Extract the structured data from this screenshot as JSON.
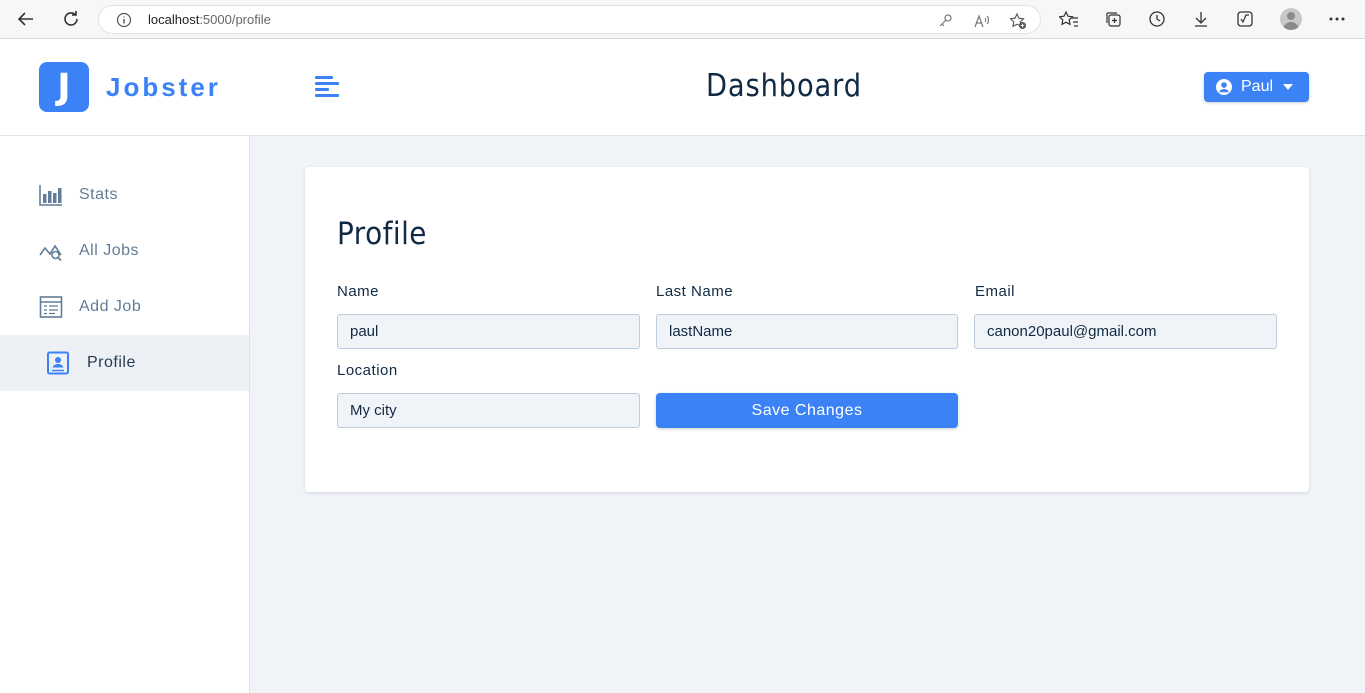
{
  "browser": {
    "url_host": "localhost",
    "url_path": ":5000/profile"
  },
  "app": {
    "logo_letter": "J",
    "logo_text": "Jobster",
    "page_title": "Dashboard",
    "user_name": "Paul",
    "accent_color": "#3b82f6"
  },
  "sidebar": {
    "items": [
      {
        "label": "Stats",
        "icon": "bar-chart-icon"
      },
      {
        "label": "All Jobs",
        "icon": "query-stats-icon"
      },
      {
        "label": "Add Job",
        "icon": "form-icon"
      },
      {
        "label": "Profile",
        "icon": "profile-card-icon",
        "active": true
      }
    ]
  },
  "profile": {
    "title": "Profile",
    "fields": {
      "name": {
        "label": "Name",
        "value": "paul"
      },
      "last_name": {
        "label": "Last Name",
        "value": "lastName"
      },
      "email": {
        "label": "Email",
        "value": "canon20paul@gmail.com"
      },
      "location": {
        "label": "Location",
        "value": "My city"
      }
    },
    "save_label": "Save Changes"
  }
}
